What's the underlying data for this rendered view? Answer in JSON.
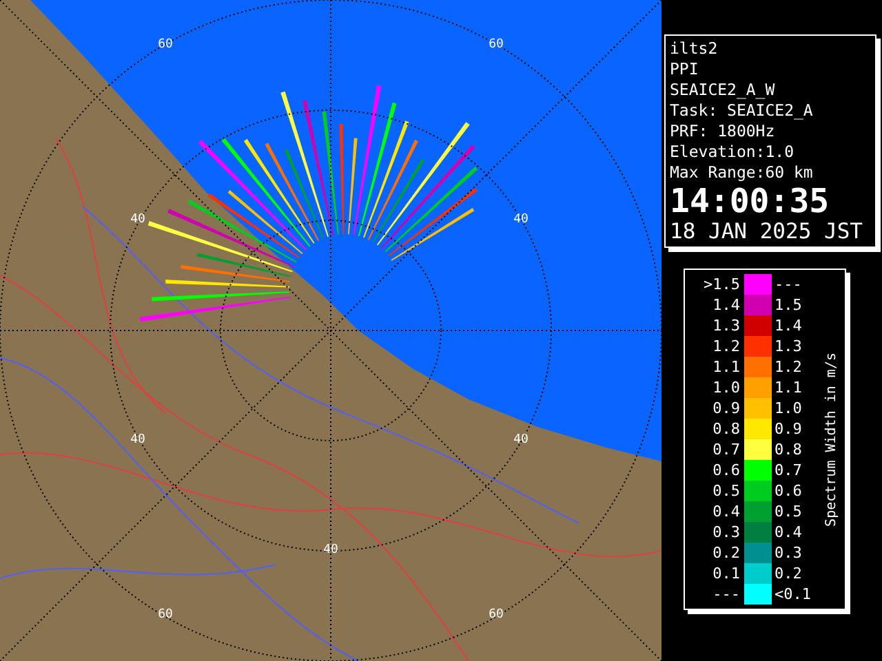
{
  "map": {
    "range_labels": [
      "60",
      "60",
      "40",
      "40",
      "40",
      "40",
      "40",
      "60",
      "60"
    ]
  },
  "info": {
    "lines": [
      "ilts2",
      "PPI",
      "SEAICE2_A_W",
      "Task: SEAICE2_A",
      "PRF: 1800Hz",
      "Elevation:1.0",
      "Max Range:60 km"
    ],
    "time": "14:00:35",
    "date": "18 JAN 2025 JST"
  },
  "legend": {
    "title": "Spectrum Width in m/s",
    "rows": [
      {
        "low": ">1.5",
        "high": "---",
        "color": "#ff00ff"
      },
      {
        "low": "1.4",
        "high": "1.5",
        "color": "#d000b0"
      },
      {
        "low": "1.3",
        "high": "1.4",
        "color": "#d00000"
      },
      {
        "low": "1.2",
        "high": "1.3",
        "color": "#ff3000"
      },
      {
        "low": "1.1",
        "high": "1.2",
        "color": "#ff7000"
      },
      {
        "low": "1.0",
        "high": "1.1",
        "color": "#ffa000"
      },
      {
        "low": "0.9",
        "high": "1.0",
        "color": "#ffc000"
      },
      {
        "low": "0.8",
        "high": "0.9",
        "color": "#ffe800"
      },
      {
        "low": "0.7",
        "high": "0.8",
        "color": "#ffff40"
      },
      {
        "low": "0.6",
        "high": "0.7",
        "color": "#00ff00"
      },
      {
        "low": "0.5",
        "high": "0.6",
        "color": "#00cc20"
      },
      {
        "low": "0.4",
        "high": "0.5",
        "color": "#00a030"
      },
      {
        "low": "0.3",
        "high": "0.4",
        "color": "#008040"
      },
      {
        "low": "0.2",
        "high": "0.3",
        "color": "#009090"
      },
      {
        "low": "0.1",
        "high": "0.2",
        "color": "#00cccc"
      },
      {
        "low": "---",
        "high": "<0.1",
        "color": "#00ffff"
      }
    ]
  }
}
